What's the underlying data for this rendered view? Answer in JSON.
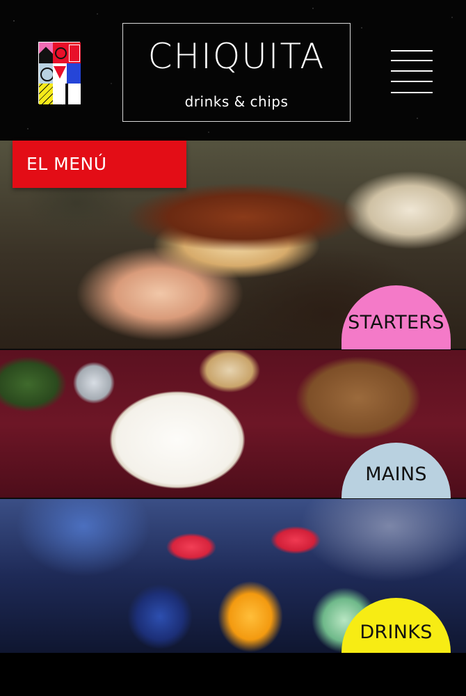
{
  "header": {
    "brand_name": "CHIQUITA",
    "tagline": "drinks & chips",
    "menu_icon": "hamburger-icon",
    "logo_icon": "geometric-tile-logo"
  },
  "menu_label": "EL MENÚ",
  "sections": {
    "starters": "STARTERS",
    "mains": "MAINS",
    "drinks": "DRINKS"
  },
  "colors": {
    "red": "#e30d16",
    "pink": "#f47ac8",
    "light_blue": "#b9d1e0",
    "yellow": "#f7ec14",
    "background": "#000000"
  }
}
